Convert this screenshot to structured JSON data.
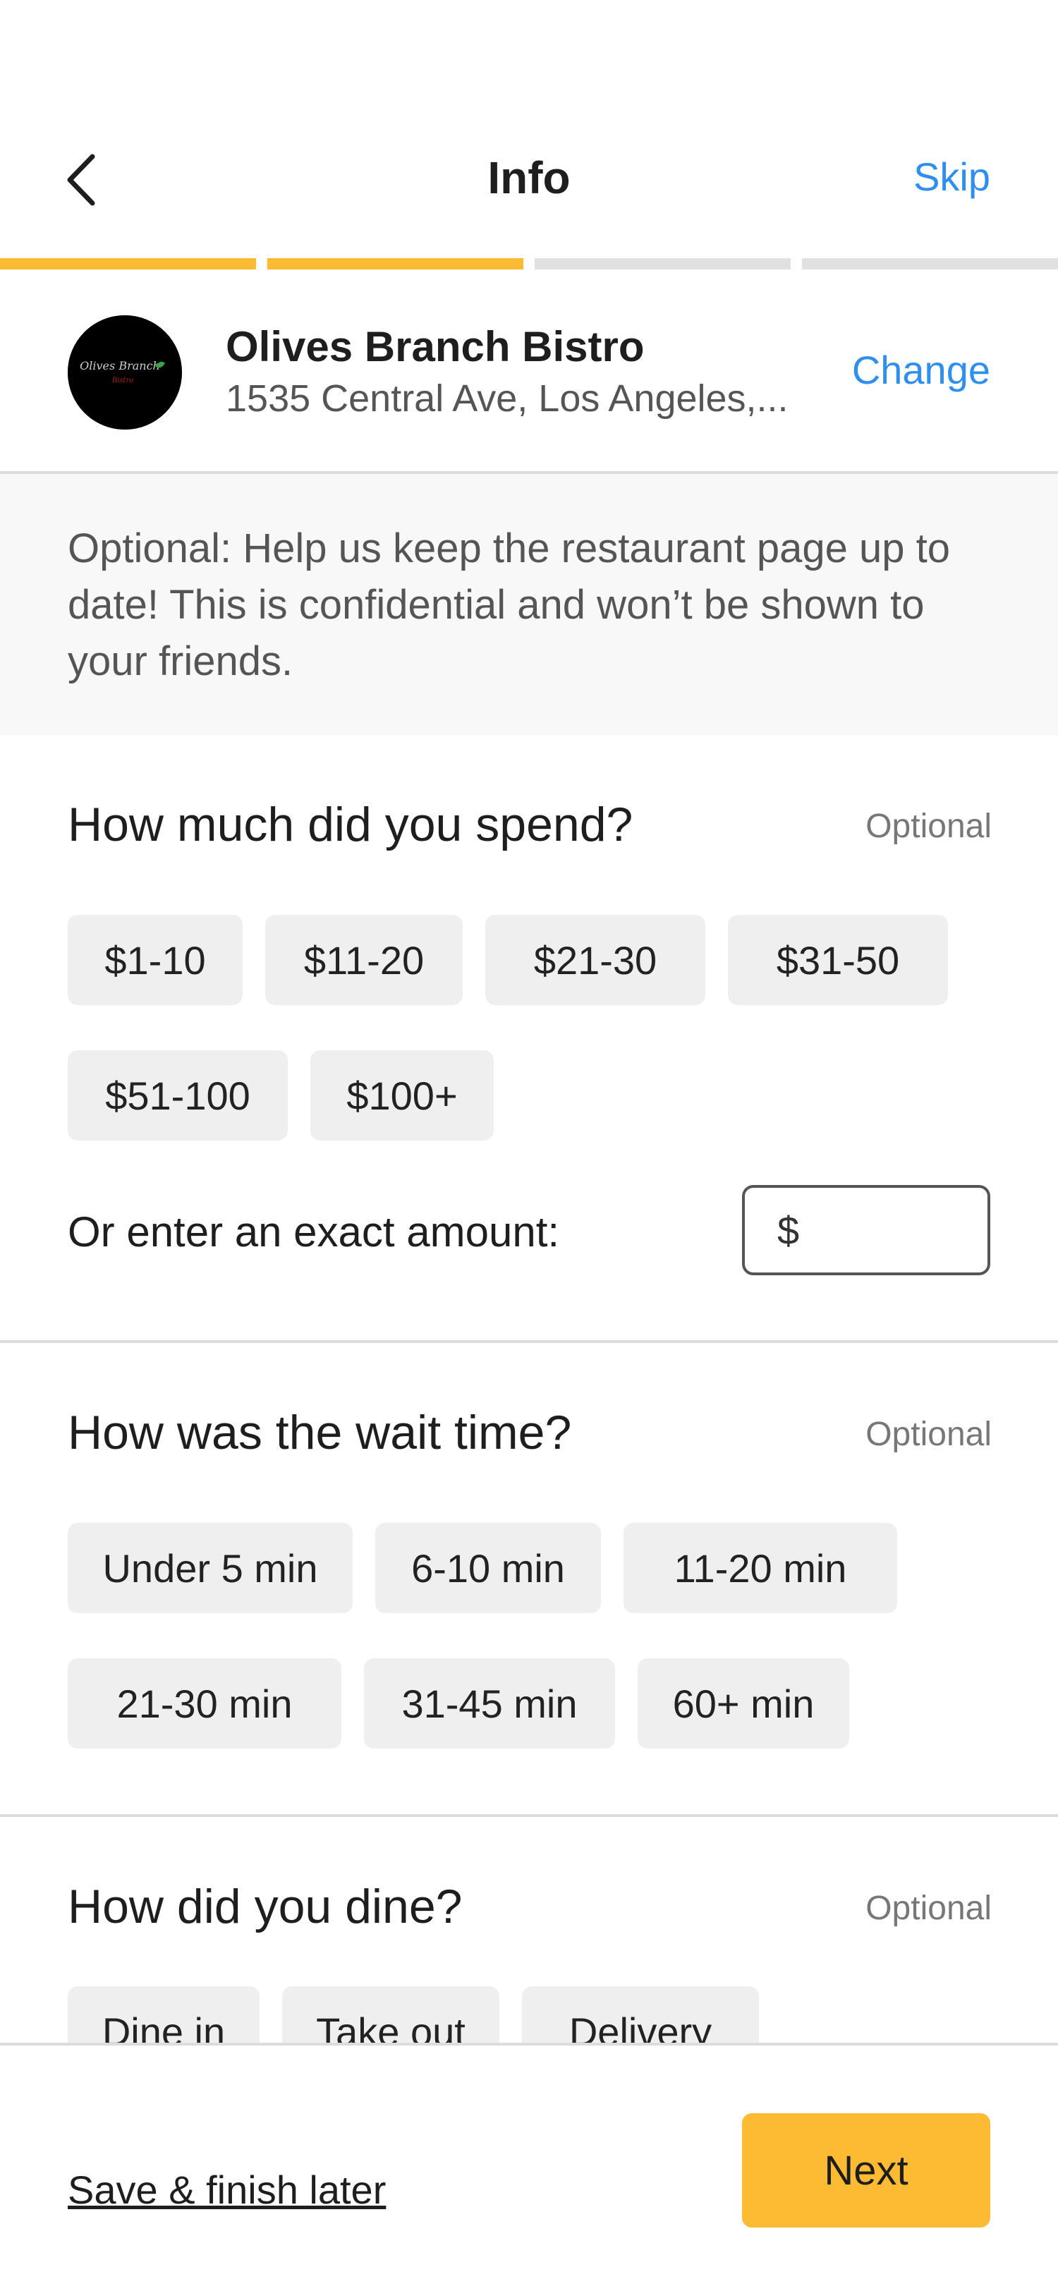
{
  "header": {
    "title": "Info",
    "skip_label": "Skip",
    "back_icon": "chevron-left-icon"
  },
  "progress": {
    "total_steps": 4,
    "completed_steps": 2,
    "accent_color": "#fcbb33"
  },
  "restaurant": {
    "name": "Olives Branch Bistro",
    "address": "1535 Central Ave, Los Angeles,...",
    "change_label": "Change",
    "logo_text": "Olives Branch"
  },
  "notice": {
    "text": "Optional: Help us keep the restaurant page up to date! This is confidential and won’t be shown to your friends."
  },
  "spend": {
    "question": "How much did you spend?",
    "optional_label": "Optional",
    "options": [
      "$1-10",
      "$11-20",
      "$21-30",
      "$31-50",
      "$51-100",
      "$100+"
    ],
    "exact_label": "Or enter an exact amount:",
    "currency_symbol": "$"
  },
  "wait": {
    "question": "How was the wait time?",
    "optional_label": "Optional",
    "options": [
      "Under 5 min",
      "6-10 min",
      "11-20 min",
      "21-30 min",
      "31-45 min",
      "60+ min"
    ]
  },
  "dine": {
    "question": "How did you dine?",
    "optional_label": "Optional",
    "options": [
      "Dine in",
      "Take out",
      "Delivery"
    ]
  },
  "footer": {
    "save_later_label": "Save & finish later",
    "next_label": "Next"
  },
  "colors": {
    "link": "#2f8fee",
    "accent": "#fcbb33",
    "chip_bg": "#efefef"
  }
}
